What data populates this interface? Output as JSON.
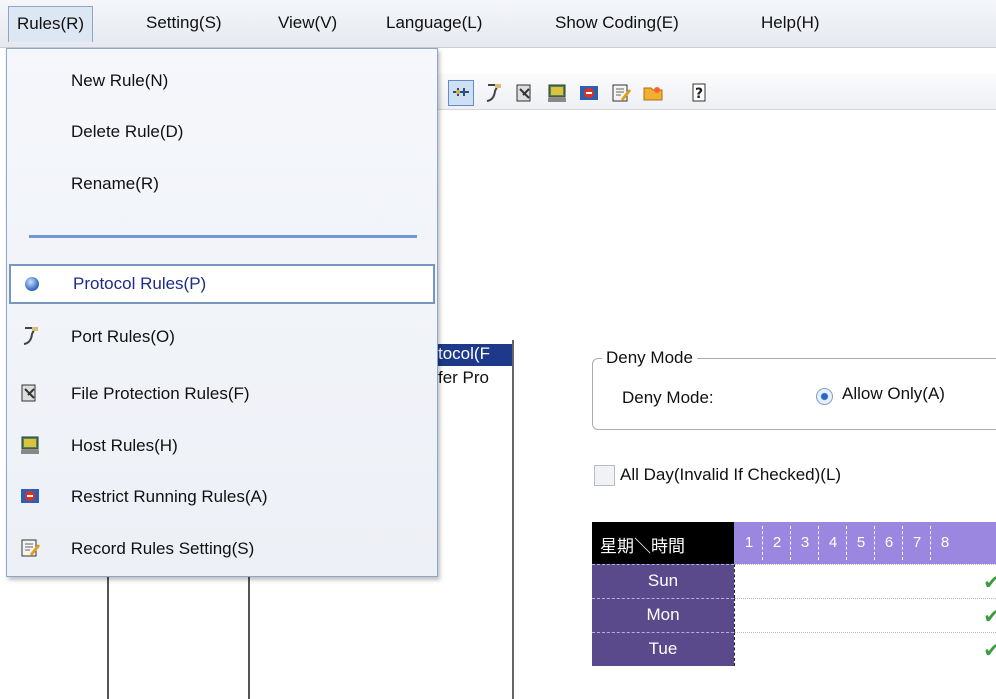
{
  "menubar": {
    "items": [
      {
        "label": "Rules(R)"
      },
      {
        "label": "Setting(S)"
      },
      {
        "label": "View(V)"
      },
      {
        "label": "Language(L)"
      },
      {
        "label": "Show Coding(E)"
      },
      {
        "label": "Help(H)"
      }
    ]
  },
  "rules_menu": {
    "new_rule": "New Rule(N)",
    "delete_rule": "Delete Rule(D)",
    "rename": "Rename(R)",
    "protocol_rules": "Protocol Rules(P)",
    "port_rules": "Port Rules(O)",
    "file_protection_rules": "File Protection Rules(F)",
    "host_rules": "Host Rules(H)",
    "restrict_running_rules": "Restrict Running Rules(A)",
    "record_rules_setting": "Record Rules Setting(S)"
  },
  "toolbar": {
    "icons": [
      "protocol-rules-icon",
      "port-rules-icon",
      "file-protection-icon",
      "host-rules-icon",
      "restrict-running-icon",
      "record-rules-icon",
      "open-folder-icon",
      "help-icon"
    ]
  },
  "rule_list": {
    "items": [
      "tocol(F",
      "fer Pro"
    ]
  },
  "deny_mode": {
    "group_title": "Deny Mode",
    "label": "Deny Mode:",
    "option": "Allow Only(A)"
  },
  "all_day": {
    "label": "All Day(Invalid If Checked)(L)",
    "checked": false
  },
  "schedule": {
    "corner_label": "星期＼時間",
    "hours": [
      "1",
      "2",
      "3",
      "4",
      "5",
      "6",
      "7",
      "8"
    ],
    "days": [
      "Sun",
      "Mon",
      "Tue"
    ],
    "checkmark": "✔",
    "header_color": "#9b87e0",
    "day_color": "#5a4a8c"
  }
}
